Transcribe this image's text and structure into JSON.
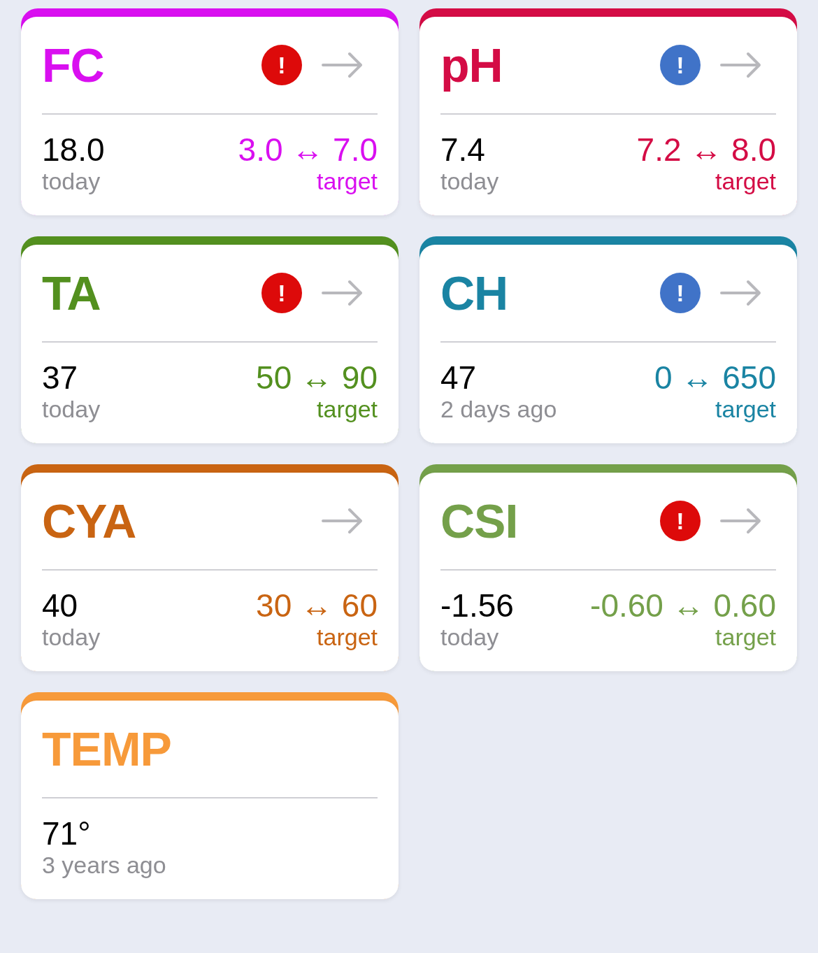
{
  "cards": [
    {
      "title": "FC",
      "color": "#d90ff0",
      "alert": {
        "kind": "error",
        "text": "!"
      },
      "link": true,
      "value": "18.0",
      "when": "today",
      "target": {
        "range": "3.0 ↔ 7.0",
        "label": "target"
      }
    },
    {
      "title": "pH",
      "color": "#d40c45",
      "alert": {
        "kind": "info",
        "text": "!"
      },
      "link": true,
      "value": "7.4",
      "when": "today",
      "target": {
        "range": "7.2 ↔ 8.0",
        "label": "target"
      }
    },
    {
      "title": "TA",
      "color": "#53901f",
      "alert": {
        "kind": "error",
        "text": "!"
      },
      "link": true,
      "value": "37",
      "when": "today",
      "target": {
        "range": "50 ↔ 90",
        "label": "target"
      }
    },
    {
      "title": "CH",
      "color": "#1a84a3",
      "alert": {
        "kind": "info",
        "text": "!"
      },
      "link": true,
      "value": "47",
      "when": "2 days ago",
      "target": {
        "range": "0 ↔ 650",
        "label": "target"
      }
    },
    {
      "title": "CYA",
      "color": "#c96412",
      "link": true,
      "value": "40",
      "when": "today",
      "target": {
        "range": "30 ↔ 60",
        "label": "target"
      }
    },
    {
      "title": "CSI",
      "color": "#74a04a",
      "alert": {
        "kind": "error",
        "text": "!"
      },
      "link": true,
      "value": "-1.56",
      "when": "today",
      "target": {
        "range": "-0.60 ↔ 0.60",
        "label": "target"
      }
    },
    {
      "title": "TEMP",
      "color": "#f79a3a",
      "link": false,
      "value": "71°",
      "when": "3 years ago"
    }
  ]
}
